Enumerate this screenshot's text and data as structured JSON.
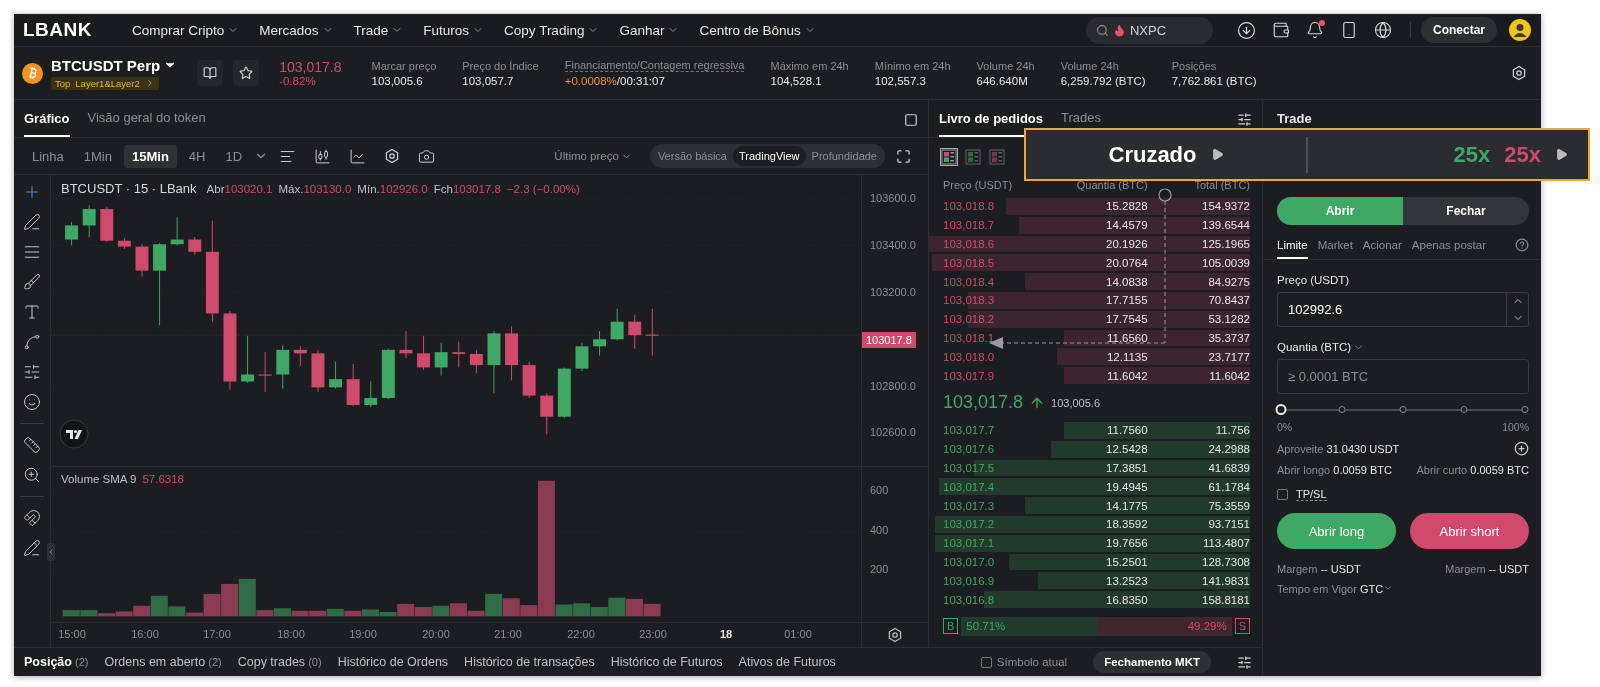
{
  "nav": {
    "logo": "LBANK",
    "menus": [
      {
        "label": "Comprar Cripto"
      },
      {
        "label": "Mercados"
      },
      {
        "label": "Trade"
      },
      {
        "label": "Futuros"
      },
      {
        "label": "Copy Trading"
      },
      {
        "label": "Ganhar"
      },
      {
        "label": "Centro de Bônus"
      }
    ],
    "search": {
      "value": "NXPC"
    },
    "has_alert": true,
    "connect": "Conectar"
  },
  "ticker": {
    "symbol": "BTCUSDT Perp",
    "tags": [
      "Top",
      "Layer1&Layer2"
    ],
    "price": "103,017.8",
    "change": "-0.82%",
    "stats": [
      {
        "kind": "plain",
        "label": "Marcar preço",
        "value": "103,005.6"
      },
      {
        "kind": "plain",
        "label": "Preço do Índice",
        "value": "103,057.7"
      },
      {
        "kind": "funding",
        "label": "Financiamento/Contagem regressiva",
        "rate": "+0.0008%",
        "countdown": "/00:31:07"
      },
      {
        "kind": "plain",
        "label": "Máximo em 24h",
        "value": "104,528.1"
      },
      {
        "kind": "plain",
        "label": "Mínimo em 24h",
        "value": "102,557.3"
      },
      {
        "kind": "plain",
        "label": "Volume 24h",
        "value": "646.640M"
      },
      {
        "kind": "plain",
        "label": "Volume 24h",
        "value": "6,259.792 (BTC)"
      },
      {
        "kind": "plain",
        "label": "Posições",
        "value": "7,762.861 (BTC)"
      }
    ]
  },
  "chart": {
    "tabs": [
      {
        "label": "Gráfico",
        "selected": true
      },
      {
        "label": "Visão geral do token",
        "selected": false
      }
    ],
    "intervals": [
      {
        "label": "Linha",
        "selected": false
      },
      {
        "label": "1Min",
        "selected": false
      },
      {
        "label": "15Min",
        "selected": true
      },
      {
        "label": "4H",
        "selected": false
      },
      {
        "label": "1D",
        "selected": false
      }
    ],
    "price_source": "Último preço",
    "views": [
      {
        "label": "Versão básica",
        "selected": false
      },
      {
        "label": "TradingView",
        "selected": true
      },
      {
        "label": "Profundidade",
        "selected": false
      }
    ],
    "legend": {
      "title": "BTCUSDT · 15 · LBank",
      "items": [
        {
          "label": "Abr",
          "value": "103020.1"
        },
        {
          "label": "Máx.",
          "value": "103130.0"
        },
        {
          "label": "Mín.",
          "value": "102926.0"
        },
        {
          "label": "Fch",
          "value": "103017.8"
        }
      ],
      "change": "−2.3 (−0.00%)"
    },
    "price_axis": [
      "103600.0",
      "103400.0",
      "103200.0",
      "102800.0",
      "102600.0"
    ],
    "last_price": "103017.8",
    "volume_legend": {
      "label": "Volume SMA 9",
      "value": "57.6318"
    },
    "volume_axis": [
      "600",
      "400",
      "200"
    ],
    "time_axis": [
      {
        "label": "15:00",
        "kind": "time"
      },
      {
        "label": "16:00",
        "kind": "time"
      },
      {
        "label": "17:00",
        "kind": "time"
      },
      {
        "label": "18:00",
        "kind": "time"
      },
      {
        "label": "19:00",
        "kind": "time"
      },
      {
        "label": "20:00",
        "kind": "time"
      },
      {
        "label": "21:00",
        "kind": "time"
      },
      {
        "label": "22:00",
        "kind": "time"
      },
      {
        "label": "23:00",
        "kind": "time"
      },
      {
        "label": "18",
        "kind": "day"
      },
      {
        "label": "01:00",
        "kind": "time"
      }
    ]
  },
  "book": {
    "tabs": [
      {
        "label": "Livro de pedidos",
        "selected": true
      },
      {
        "label": "Trades",
        "selected": false
      }
    ],
    "layouts": [
      {
        "kind": "both",
        "selected": true
      },
      {
        "kind": "bids",
        "selected": false
      },
      {
        "kind": "asks",
        "selected": false
      }
    ],
    "columns": [
      "Preço (USDT)",
      "Quantia (BTC)",
      "Total (BTC)"
    ],
    "asks": [
      {
        "price": "103,018.8",
        "amount": "15.2828",
        "total": "154.9372",
        "level": 0.76
      },
      {
        "price": "103,018.7",
        "amount": "14.4579",
        "total": "139.6544",
        "level": 0.72
      },
      {
        "price": "103,018.6",
        "amount": "20.1926",
        "total": "125.1965",
        "level": 1.0
      },
      {
        "price": "103,018.5",
        "amount": "20.0764",
        "total": "105.0039",
        "level": 0.99
      },
      {
        "price": "103,018.4",
        "amount": "14.0838",
        "total": "84.9275",
        "level": 0.7
      },
      {
        "price": "103,018.3",
        "amount": "17.7155",
        "total": "70.8437",
        "level": 0.88
      },
      {
        "price": "103,018.2",
        "amount": "17.7545",
        "total": "53.1282",
        "level": 0.88
      },
      {
        "price": "103,018.1",
        "amount": "11.6560",
        "total": "35.3737",
        "level": 0.58
      },
      {
        "price": "103,018.0",
        "amount": "12.1135",
        "total": "23.7177",
        "level": 0.6
      },
      {
        "price": "103,017.9",
        "amount": "11.6042",
        "total": "11.6042",
        "level": 0.58
      }
    ],
    "mid": {
      "price": "103,017.8",
      "mark": "103,005.6"
    },
    "bids": [
      {
        "price": "103,017.7",
        "amount": "11.7560",
        "total": "11.756",
        "level": 0.58
      },
      {
        "price": "103,017.6",
        "amount": "12.5428",
        "total": "24.2988",
        "level": 0.62
      },
      {
        "price": "103,017.5",
        "amount": "17.3851",
        "total": "41.6839",
        "level": 0.86
      },
      {
        "price": "103,017.4",
        "amount": "19.4945",
        "total": "61.1784",
        "level": 0.97
      },
      {
        "price": "103,017.3",
        "amount": "14.1775",
        "total": "75.3559",
        "level": 0.7
      },
      {
        "price": "103,017.2",
        "amount": "18.3592",
        "total": "93.7151",
        "level": 0.98
      },
      {
        "price": "103,017.1",
        "amount": "19.7656",
        "total": "113.4807",
        "level": 0.98
      },
      {
        "price": "103,017.0",
        "amount": "15.2501",
        "total": "128.7308",
        "level": 0.75
      },
      {
        "price": "103,016.9",
        "amount": "13.2523",
        "total": "141.9831",
        "level": 0.66
      },
      {
        "price": "103,016.8",
        "amount": "16.8350",
        "total": "158.8181",
        "level": 0.83
      }
    ],
    "ratio": {
      "buy_mark": "B",
      "buy": "50.71%",
      "sell": "49.29%",
      "sell_mark": "S",
      "level": 0.5071
    }
  },
  "bottom": {
    "tabs": [
      {
        "label": "Posição",
        "count": "(2)",
        "selected": true
      },
      {
        "label": "Ordens em aberto",
        "count": "(2)",
        "selected": false
      },
      {
        "label": "Copy trades",
        "count": "(0)",
        "selected": false
      },
      {
        "label": "Histórico de Ordens",
        "selected": false
      },
      {
        "label": "Histórico de transações",
        "selected": false
      },
      {
        "label": "Histórico de Futuros",
        "selected": false
      },
      {
        "label": "Ativos de Futuros",
        "selected": false
      }
    ],
    "current_symbol": {
      "label": "Símbolo atual",
      "checked": false
    },
    "close_button": "Fechamento MKT"
  },
  "trade": {
    "title": "Trade",
    "sides": [
      {
        "label": "Abrir",
        "selected": true
      },
      {
        "label": "Fechar",
        "selected": false
      }
    ],
    "order_types": [
      {
        "label": "Limite",
        "selected": true
      },
      {
        "label": "Market",
        "selected": false
      },
      {
        "label": "Acionar",
        "selected": false
      },
      {
        "label": "Apenas postar",
        "selected": false
      }
    ],
    "price": {
      "label": "Preço (USDT)",
      "value": "102992.6"
    },
    "quantity": {
      "label": "Quantia (BTC)",
      "placeholder": "≥ 0.0001 BTC"
    },
    "slider": {
      "level": 0,
      "min": "0%",
      "max": "100%"
    },
    "available": {
      "label": "Aproveite",
      "value": "31.0430 USDT"
    },
    "open_long_max": {
      "label": "Abrir longo",
      "value": "0.0059 BTC"
    },
    "open_short_max": {
      "label": "Abrir curto",
      "value": "0.0059 BTC"
    },
    "tpsl": {
      "label": "TP/SL",
      "checked": false
    },
    "buttons": [
      {
        "kind": "long",
        "label": "Abrir long"
      },
      {
        "kind": "short",
        "label": "Abrir short"
      }
    ],
    "margins": [
      {
        "label": "Margem",
        "value": "--",
        "unit": "USDT"
      },
      {
        "label": "Margem",
        "value": "--",
        "unit": "USDT"
      }
    ],
    "time_in_force": {
      "label": "Tempo em Vigor",
      "value": "GTC"
    }
  },
  "callout": {
    "margin_mode": "Cruzado",
    "leverage_long": "25x",
    "leverage_short": "25x"
  }
}
